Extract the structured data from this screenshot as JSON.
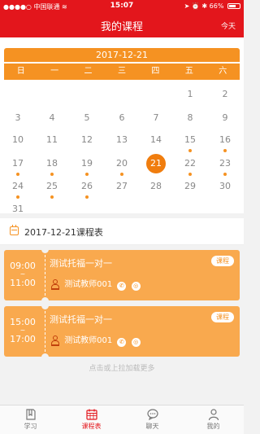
{
  "status_bar": {
    "carrier": "中国联通",
    "time": "15:07",
    "battery": "66%",
    "battery_level": 0.66
  },
  "nav": {
    "title": "我的课程",
    "today_button": "今天"
  },
  "calendar": {
    "month_label": "2017-12-21",
    "weekdays": [
      "日",
      "一",
      "二",
      "三",
      "四",
      "五",
      "六"
    ],
    "days": [
      {
        "label": "1",
        "col": 5,
        "row": 0,
        "dot": false
      },
      {
        "label": "2",
        "col": 6,
        "row": 0,
        "dot": false
      },
      {
        "label": "3",
        "col": 0,
        "row": 1,
        "dot": false
      },
      {
        "label": "4",
        "col": 1,
        "row": 1,
        "dot": false
      },
      {
        "label": "5",
        "col": 2,
        "row": 1,
        "dot": false
      },
      {
        "label": "6",
        "col": 3,
        "row": 1,
        "dot": false
      },
      {
        "label": "7",
        "col": 4,
        "row": 1,
        "dot": false
      },
      {
        "label": "8",
        "col": 5,
        "row": 1,
        "dot": false
      },
      {
        "label": "9",
        "col": 6,
        "row": 1,
        "dot": false
      },
      {
        "label": "10",
        "col": 0,
        "row": 2,
        "dot": false
      },
      {
        "label": "11",
        "col": 1,
        "row": 2,
        "dot": false
      },
      {
        "label": "12",
        "col": 2,
        "row": 2,
        "dot": false
      },
      {
        "label": "13",
        "col": 3,
        "row": 2,
        "dot": false
      },
      {
        "label": "14",
        "col": 4,
        "row": 2,
        "dot": false
      },
      {
        "label": "15",
        "col": 5,
        "row": 2,
        "dot": true
      },
      {
        "label": "16",
        "col": 6,
        "row": 2,
        "dot": true
      },
      {
        "label": "17",
        "col": 0,
        "row": 3,
        "dot": true
      },
      {
        "label": "18",
        "col": 1,
        "row": 3,
        "dot": true
      },
      {
        "label": "19",
        "col": 2,
        "row": 3,
        "dot": true
      },
      {
        "label": "20",
        "col": 3,
        "row": 3,
        "dot": true
      },
      {
        "label": "21",
        "col": 4,
        "row": 3,
        "dot": false,
        "selected": true
      },
      {
        "label": "22",
        "col": 5,
        "row": 3,
        "dot": true
      },
      {
        "label": "23",
        "col": 6,
        "row": 3,
        "dot": true
      },
      {
        "label": "24",
        "col": 0,
        "row": 4,
        "dot": true
      },
      {
        "label": "25",
        "col": 1,
        "row": 4,
        "dot": true
      },
      {
        "label": "26",
        "col": 2,
        "row": 4,
        "dot": true
      },
      {
        "label": "27",
        "col": 3,
        "row": 4,
        "dot": false
      },
      {
        "label": "28",
        "col": 4,
        "row": 4,
        "dot": false
      },
      {
        "label": "29",
        "col": 5,
        "row": 4,
        "dot": false
      },
      {
        "label": "30",
        "col": 6,
        "row": 4,
        "dot": false
      },
      {
        "label": "31",
        "col": 0,
        "row": 5,
        "dot": false
      }
    ]
  },
  "schedule": {
    "title": "2017-12-21课程表",
    "cards": [
      {
        "start": "09:00",
        "tilde": "~",
        "end": "11:00",
        "course": "测试托福一对一",
        "badge": "课程",
        "teacher": "测试教师001"
      },
      {
        "start": "15:00",
        "tilde": "~",
        "end": "17:00",
        "course": "测试托福一对一",
        "badge": "课程",
        "teacher": "测试教师001"
      }
    ],
    "load_more": "点击或上拉加载更多"
  },
  "tabbar": {
    "items": [
      {
        "label": "学习",
        "icon": "book-icon"
      },
      {
        "label": "课程表",
        "icon": "calendar-icon",
        "active": true
      },
      {
        "label": "聊天",
        "icon": "chat-bubble-icon"
      },
      {
        "label": "我的",
        "icon": "person-icon"
      }
    ]
  },
  "colors": {
    "primary_red": "#e3161c",
    "accent_orange": "#f59222",
    "card_orange": "#f9a94e"
  }
}
